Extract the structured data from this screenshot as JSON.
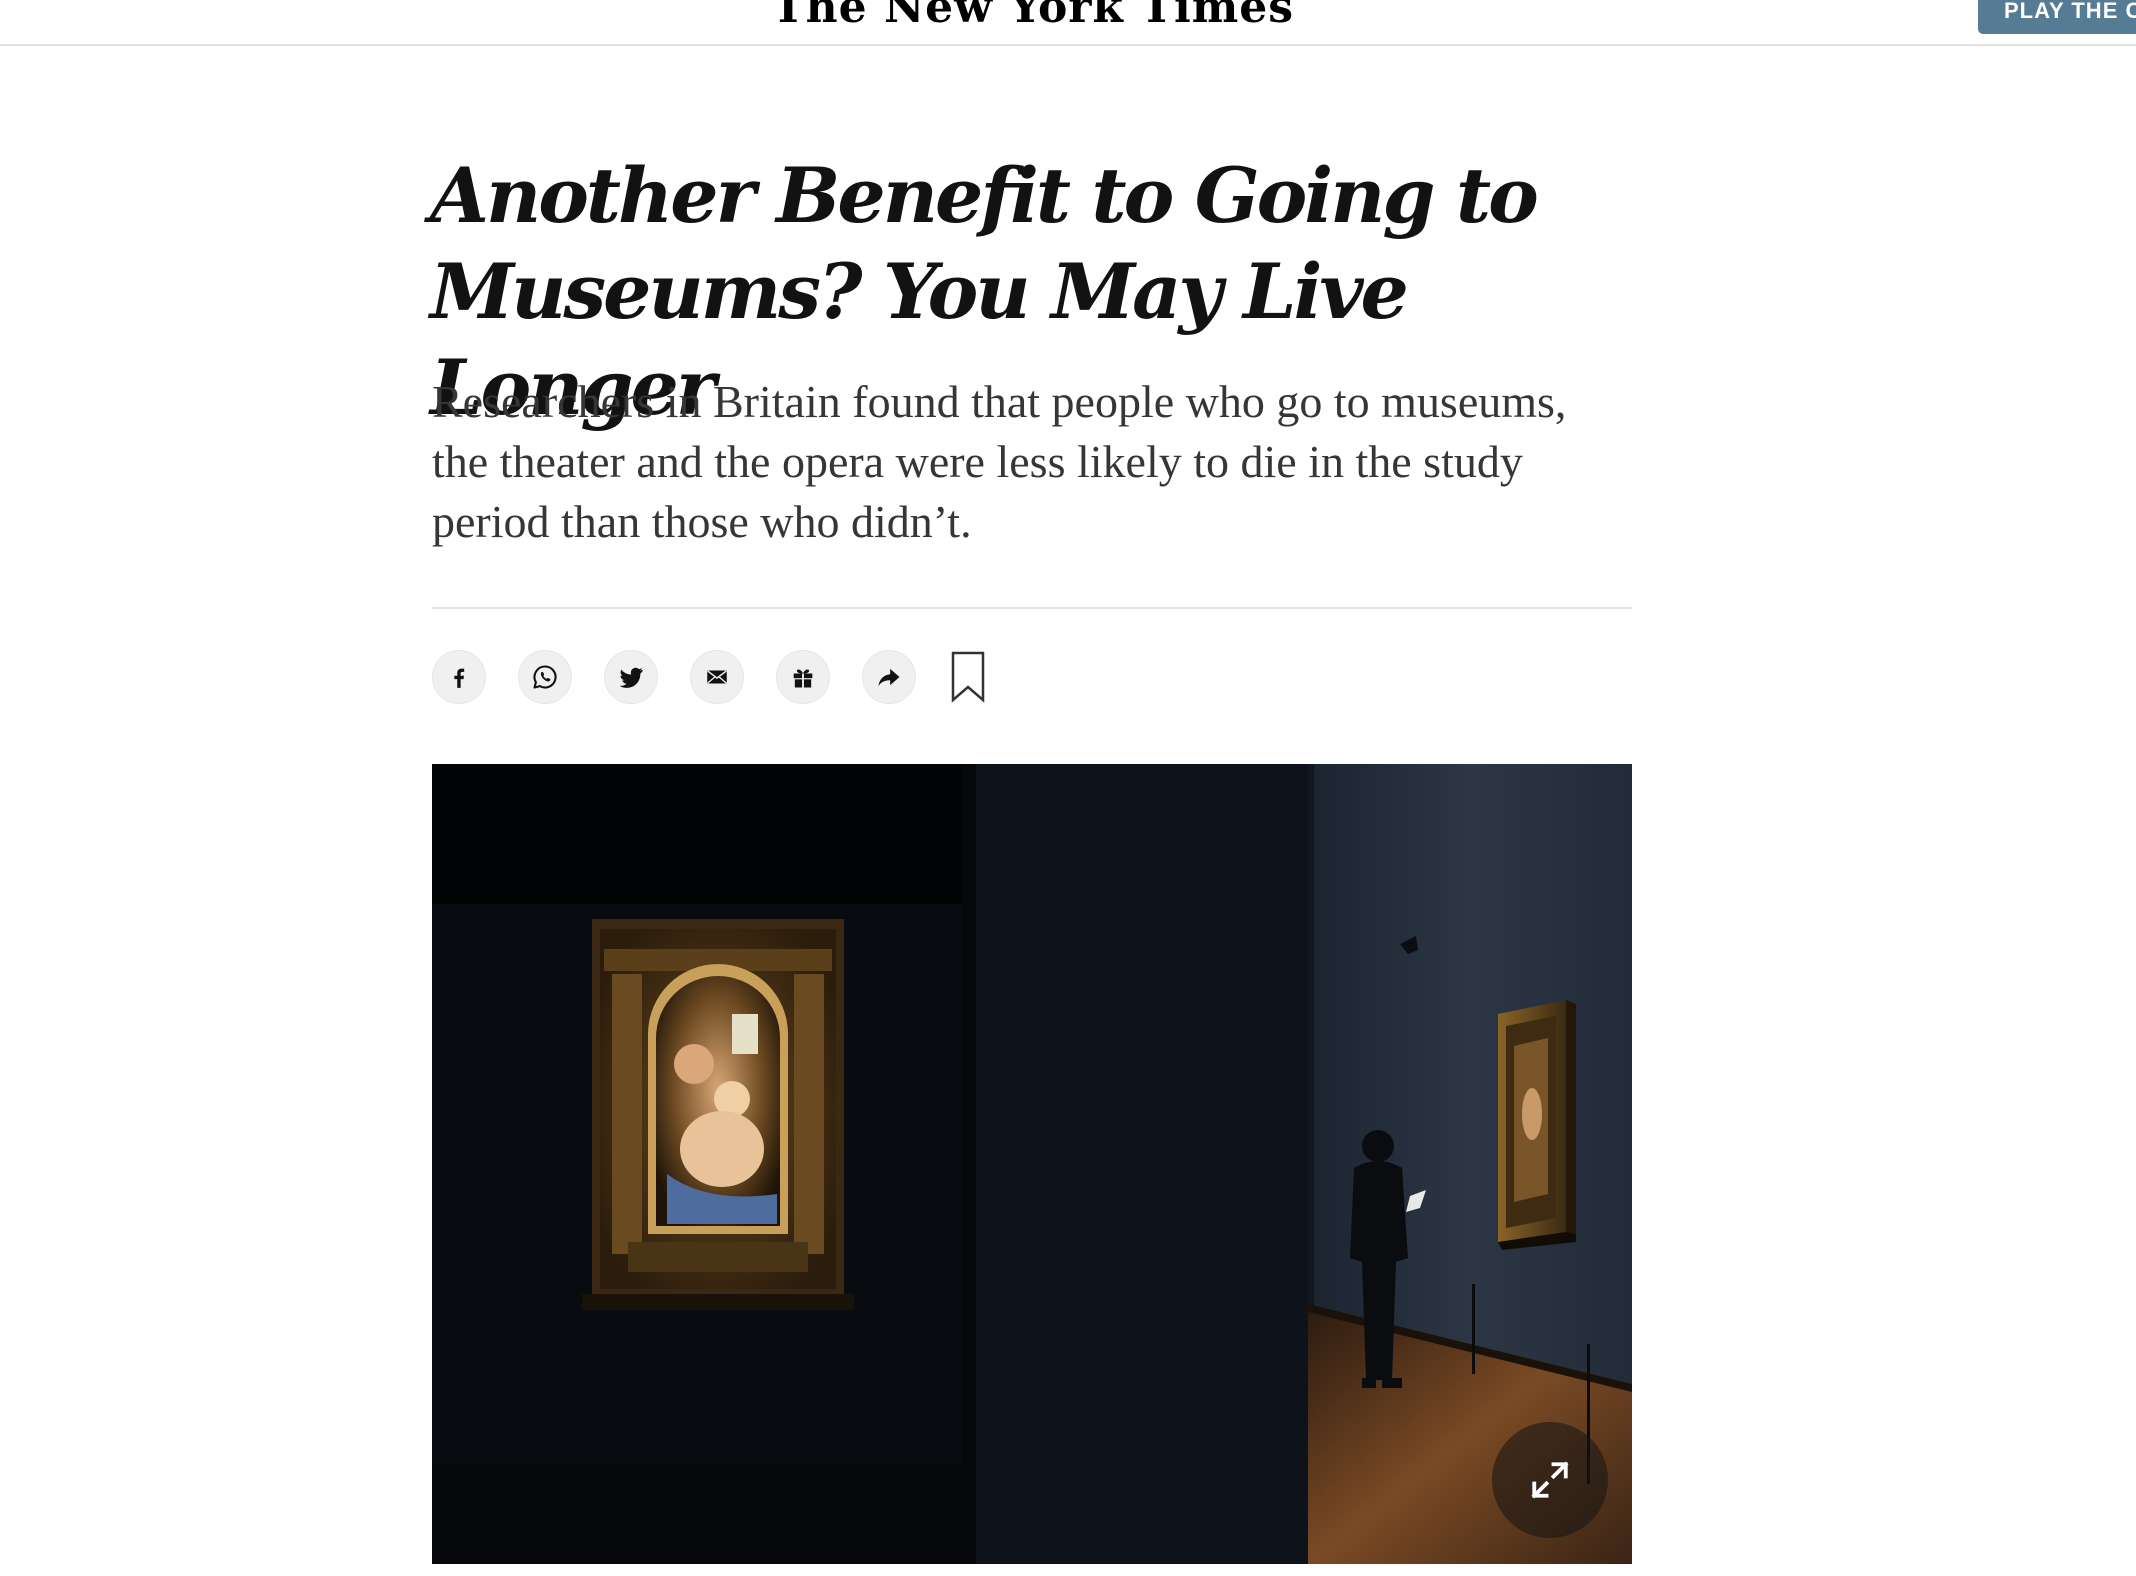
{
  "masthead": {
    "logo_text": "The New York Times",
    "play_button_label": "PLAY THE C"
  },
  "article": {
    "headline": "Another Benefit to Going to Museums? You May Live Longer",
    "summary": "Researchers in Britain found that people who go to museums, the theater and the opera were less likely to die in the study period than those who didn’t."
  },
  "share_bar": {
    "buttons": [
      {
        "icon": "facebook-icon"
      },
      {
        "icon": "whatsapp-icon"
      },
      {
        "icon": "twitter-icon"
      },
      {
        "icon": "email-icon"
      },
      {
        "icon": "gift-icon"
      },
      {
        "icon": "share-arrow-icon"
      },
      {
        "icon": "bookmark-icon"
      }
    ]
  },
  "photo": {
    "expand_icon": "expand-icon"
  },
  "colors": {
    "text": "#121212",
    "summary_text": "#363636",
    "button_bg": "#567b95",
    "rule": "#e2e2e2",
    "share_bg": "#f0f0f0"
  }
}
